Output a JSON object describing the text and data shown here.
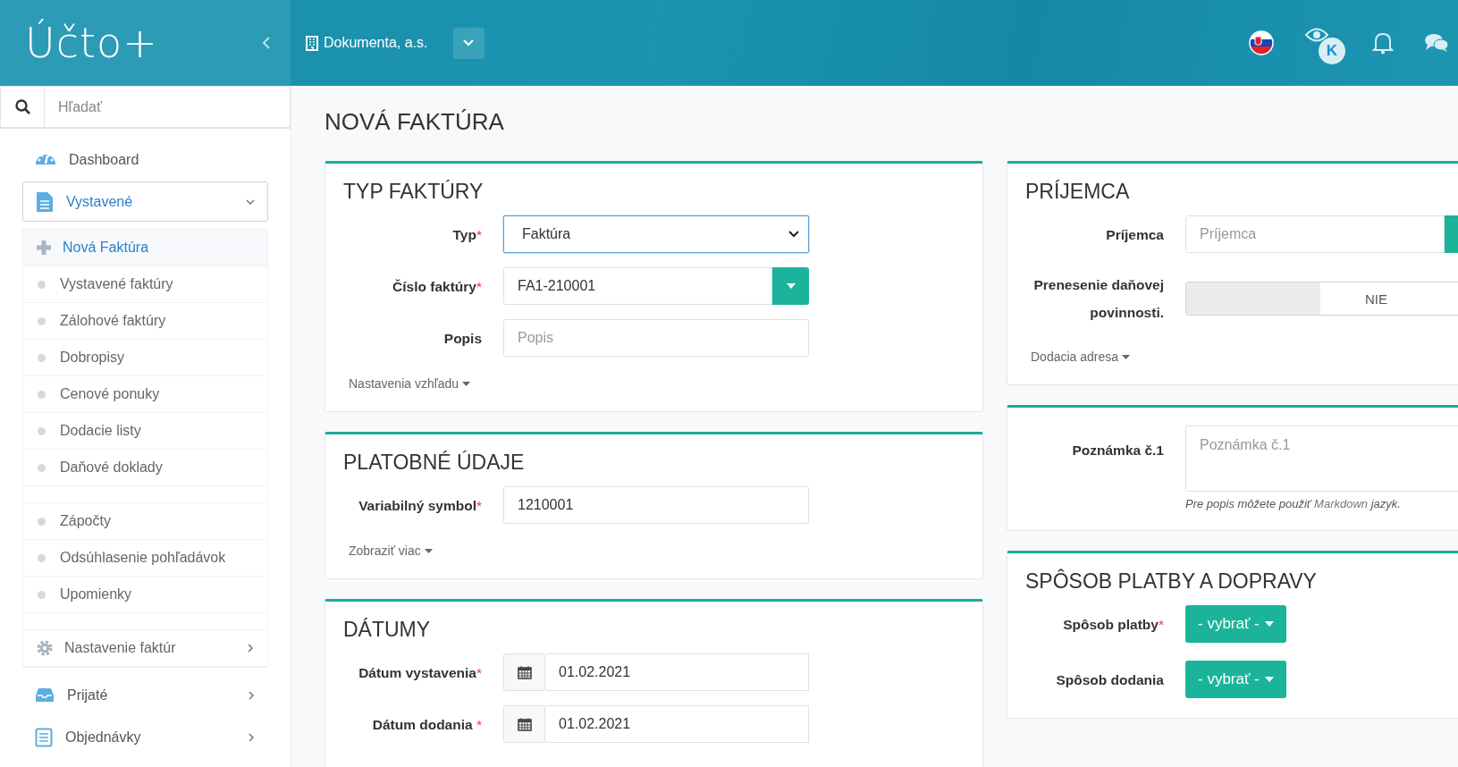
{
  "header": {
    "logo": "Účto+",
    "company": "Dokumenta, a.s.",
    "avatar_letter": "K"
  },
  "search": {
    "placeholder": "Hľadať"
  },
  "sidebar": {
    "items": [
      {
        "label": "Dashboard",
        "kind": "link"
      },
      {
        "label": "Vystavené",
        "kind": "group",
        "expanded": true,
        "children": [
          {
            "label": "Nová Faktúra",
            "kind": "new",
            "selected": true
          },
          {
            "label": "Vystavené faktúry",
            "kind": "bullet",
            "selected": false
          },
          {
            "label": "Zálohové faktúry",
            "kind": "bullet",
            "selected": false
          },
          {
            "label": "Dobropisy",
            "kind": "bullet",
            "selected": false
          },
          {
            "label": "Cenové ponuky",
            "kind": "bullet",
            "selected": false
          },
          {
            "label": "Dodacie listy",
            "kind": "bullet",
            "selected": false
          },
          {
            "label": "Daňové doklady",
            "kind": "bullet",
            "selected": false
          },
          {
            "kind": "spacer"
          },
          {
            "label": "Zápočty",
            "kind": "bullet",
            "selected": false
          },
          {
            "label": "Odsúhlasenie pohľadávok",
            "kind": "bullet",
            "selected": false
          },
          {
            "label": "Upomienky",
            "kind": "bullet",
            "selected": false
          },
          {
            "kind": "spacer"
          },
          {
            "label": "Nastavenie faktúr",
            "kind": "settings",
            "selected": false
          }
        ]
      },
      {
        "label": "Prijaté",
        "kind": "group",
        "expanded": false
      },
      {
        "label": "Objednávky",
        "kind": "group",
        "expanded": false
      }
    ]
  },
  "page_title": "NOVÁ FAKTÚRA",
  "left_cards": [
    {
      "title": "TYP FAKTÚRY",
      "fields": [
        {
          "label": "Typ",
          "required_mark": "*",
          "kind": "select",
          "value": "Faktúra"
        },
        {
          "label": "Číslo faktúry",
          "required_mark": "*",
          "kind": "input-dropdown",
          "value": "FA1-210001"
        },
        {
          "label": "Popis",
          "kind": "input",
          "placeholder": "Popis"
        }
      ],
      "more_link": "Nastavenia vzhľadu"
    },
    {
      "title": "PLATOBNÉ ÚDAJE",
      "fields": [
        {
          "label": "Variabilný symbol",
          "required_mark": "*",
          "kind": "input",
          "value": "1210001"
        }
      ],
      "more_link": "Zobraziť viac"
    },
    {
      "title": "DÁTUMY",
      "fields": [
        {
          "label": "Dátum vystavenia",
          "required_mark": "*",
          "kind": "date",
          "value": "01.02.2021"
        },
        {
          "label": "Dátum dodania ",
          "required_mark": "*",
          "kind": "date",
          "value": "01.02.2021"
        }
      ]
    }
  ],
  "right_cards": [
    {
      "title": "PRÍJEMCA",
      "fields": [
        {
          "label": "Príjemca",
          "kind": "input-button",
          "placeholder": "Príjemca"
        },
        {
          "label": "Prenesenie daňovej povinnosti.",
          "kind": "toggle",
          "on": false,
          "value": "NIE"
        }
      ],
      "more_link": "Dodacia adresa"
    },
    {
      "fields": [
        {
          "label": "Poznámka č.1",
          "kind": "textarea",
          "placeholder": "Poznámka č.1",
          "help": {
            "before": "Pre popis môžete použiť",
            "link": "Markdown",
            "after": "jazyk."
          }
        }
      ]
    },
    {
      "title": "SPÔSOB PLATBY A DOPRAVY",
      "fields": [
        {
          "label": "Spôsob platby",
          "required_mark": "*",
          "kind": "button-select",
          "value": "- vybrať -"
        },
        {
          "label": "Spôsob dodania",
          "kind": "button-select",
          "value": "- vybrať -"
        }
      ]
    }
  ]
}
